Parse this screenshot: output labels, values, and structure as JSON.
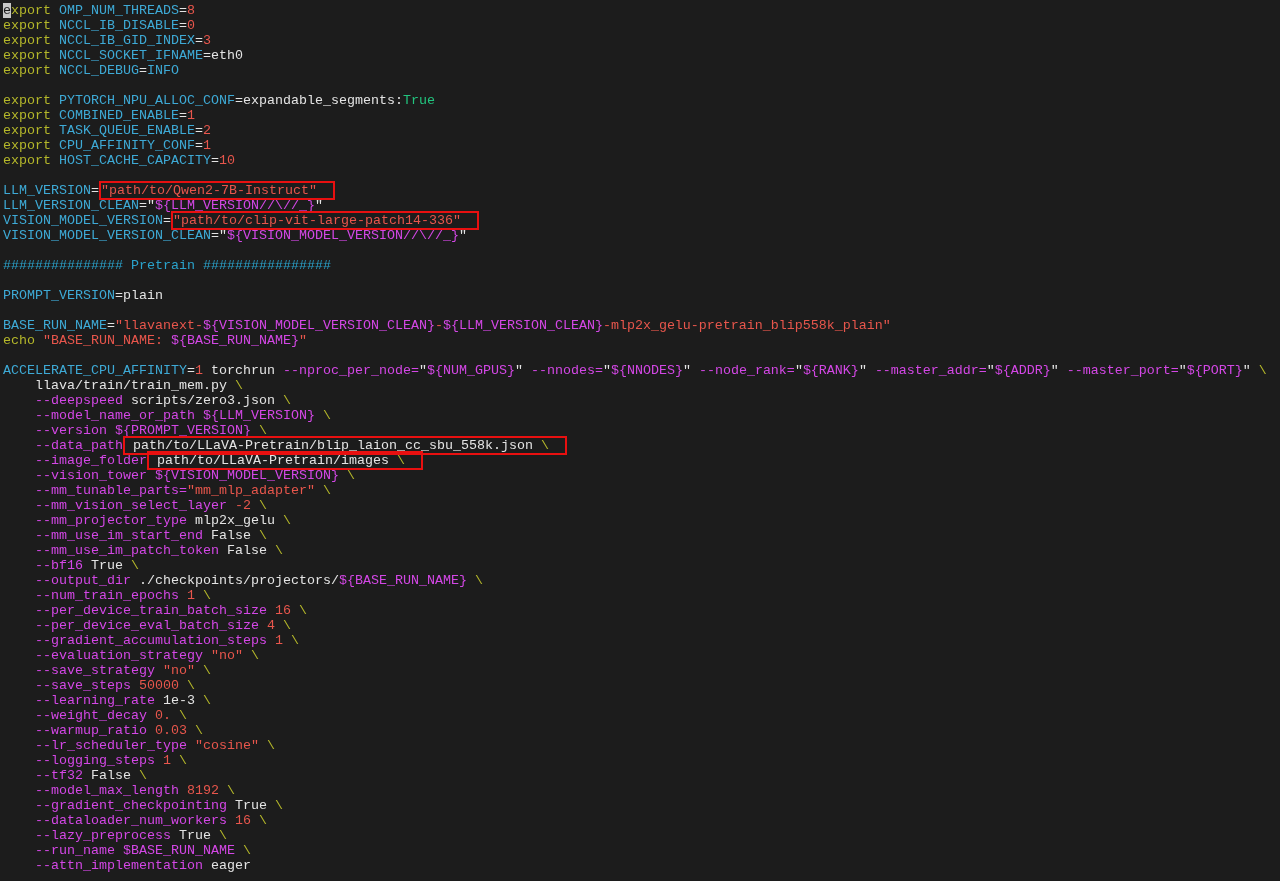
{
  "editor": {
    "lines": [
      {
        "kind": "code",
        "indented": false,
        "tokens": [
          {
            "kind": "cursor",
            "text": "e"
          },
          {
            "kind": "keyword",
            "text": "xport "
          },
          {
            "kind": "var",
            "text": "OMP_NUM_THREADS"
          },
          {
            "kind": "plain",
            "text": "="
          },
          {
            "kind": "num",
            "text": "8"
          }
        ]
      },
      {
        "kind": "code",
        "indented": false,
        "tokens": [
          {
            "kind": "keyword",
            "text": "export "
          },
          {
            "kind": "var",
            "text": "NCCL_IB_DISABLE"
          },
          {
            "kind": "plain",
            "text": "="
          },
          {
            "kind": "num",
            "text": "0"
          }
        ]
      },
      {
        "kind": "code",
        "indented": false,
        "tokens": [
          {
            "kind": "keyword",
            "text": "export "
          },
          {
            "kind": "var",
            "text": "NCCL_IB_GID_INDEX"
          },
          {
            "kind": "plain",
            "text": "="
          },
          {
            "kind": "num",
            "text": "3"
          }
        ]
      },
      {
        "kind": "code",
        "indented": false,
        "tokens": [
          {
            "kind": "keyword",
            "text": "export "
          },
          {
            "kind": "var",
            "text": "NCCL_SOCKET_IFNAME"
          },
          {
            "kind": "plain",
            "text": "=eth0"
          }
        ]
      },
      {
        "kind": "code",
        "indented": false,
        "tokens": [
          {
            "kind": "keyword",
            "text": "export "
          },
          {
            "kind": "var",
            "text": "NCCL_DEBUG"
          },
          {
            "kind": "plain",
            "text": "="
          },
          {
            "kind": "var",
            "text": "INFO"
          }
        ]
      },
      {
        "kind": "blank"
      },
      {
        "kind": "code",
        "indented": false,
        "tokens": [
          {
            "kind": "keyword",
            "text": "export "
          },
          {
            "kind": "var",
            "text": "PYTORCH_NPU_ALLOC_CONF"
          },
          {
            "kind": "plain",
            "text": "=expandable_segments:"
          },
          {
            "kind": "bool",
            "text": "True"
          }
        ]
      },
      {
        "kind": "code",
        "indented": false,
        "tokens": [
          {
            "kind": "keyword",
            "text": "export "
          },
          {
            "kind": "var",
            "text": "COMBINED_ENABLE"
          },
          {
            "kind": "plain",
            "text": "="
          },
          {
            "kind": "num",
            "text": "1"
          }
        ]
      },
      {
        "kind": "code",
        "indented": false,
        "tokens": [
          {
            "kind": "keyword",
            "text": "export "
          },
          {
            "kind": "var",
            "text": "TASK_QUEUE_ENABLE"
          },
          {
            "kind": "plain",
            "text": "="
          },
          {
            "kind": "num",
            "text": "2"
          }
        ]
      },
      {
        "kind": "code",
        "indented": false,
        "tokens": [
          {
            "kind": "keyword",
            "text": "export "
          },
          {
            "kind": "var",
            "text": "CPU_AFFINITY_CONF"
          },
          {
            "kind": "plain",
            "text": "="
          },
          {
            "kind": "num",
            "text": "1"
          }
        ]
      },
      {
        "kind": "code",
        "indented": false,
        "tokens": [
          {
            "kind": "keyword",
            "text": "export "
          },
          {
            "kind": "var",
            "text": "HOST_CACHE_CAPACITY"
          },
          {
            "kind": "plain",
            "text": "="
          },
          {
            "kind": "num",
            "text": "10"
          }
        ]
      },
      {
        "kind": "blank"
      },
      {
        "kind": "code",
        "indented": false,
        "tokens": [
          {
            "kind": "var",
            "text": "LLM_VERSION"
          },
          {
            "kind": "plain",
            "text": "="
          }
        ],
        "boxed": [
          {
            "kind": "str",
            "text": "\"path/to/Qwen2-7B-Instruct\""
          }
        ]
      },
      {
        "kind": "code",
        "indented": false,
        "tokens": [
          {
            "kind": "var",
            "text": "LLM_VERSION_CLEAN"
          },
          {
            "kind": "plain",
            "text": "=\""
          },
          {
            "kind": "expansion",
            "text": "${LLM_VERSION//\\//_}"
          },
          {
            "kind": "plain",
            "text": "\""
          }
        ]
      },
      {
        "kind": "code",
        "indented": false,
        "tokens": [
          {
            "kind": "var",
            "text": "VISION_MODEL_VERSION"
          },
          {
            "kind": "plain",
            "text": "="
          }
        ],
        "boxed": [
          {
            "kind": "str",
            "text": "\"path/to/clip-vit-large-patch14-336\""
          }
        ]
      },
      {
        "kind": "code",
        "indented": false,
        "tokens": [
          {
            "kind": "var",
            "text": "VISION_MODEL_VERSION_CLEAN"
          },
          {
            "kind": "plain",
            "text": "=\""
          },
          {
            "kind": "expansion",
            "text": "${VISION_MODEL_VERSION//\\//_}"
          },
          {
            "kind": "plain",
            "text": "\""
          }
        ]
      },
      {
        "kind": "blank"
      },
      {
        "kind": "code",
        "indented": false,
        "tokens": [
          {
            "kind": "comment",
            "text": "############### Pretrain ################"
          }
        ]
      },
      {
        "kind": "blank"
      },
      {
        "kind": "code",
        "indented": false,
        "tokens": [
          {
            "kind": "var",
            "text": "PROMPT_VERSION"
          },
          {
            "kind": "plain",
            "text": "=plain"
          }
        ]
      },
      {
        "kind": "blank"
      },
      {
        "kind": "code",
        "indented": false,
        "tokens": [
          {
            "kind": "var",
            "text": "BASE_RUN_NAME"
          },
          {
            "kind": "plain",
            "text": "="
          },
          {
            "kind": "str",
            "text": "\"llavanext-"
          },
          {
            "kind": "expansion",
            "text": "${VISION_MODEL_VERSION_CLEAN}"
          },
          {
            "kind": "str",
            "text": "-"
          },
          {
            "kind": "expansion",
            "text": "${LLM_VERSION_CLEAN}"
          },
          {
            "kind": "str",
            "text": "-mlp2x_gelu-pretrain_blip558k_plain\""
          }
        ]
      },
      {
        "kind": "code",
        "indented": false,
        "tokens": [
          {
            "kind": "keyword",
            "text": "echo "
          },
          {
            "kind": "str",
            "text": "\"BASE_RUN_NAME: "
          },
          {
            "kind": "expansion",
            "text": "${BASE_RUN_NAME}"
          },
          {
            "kind": "str",
            "text": "\""
          }
        ]
      },
      {
        "kind": "blank"
      },
      {
        "kind": "code",
        "indented": false,
        "tokens": [
          {
            "kind": "var",
            "text": "ACCELERATE_CPU_AFFINITY"
          },
          {
            "kind": "plain",
            "text": "="
          },
          {
            "kind": "num",
            "text": "1"
          },
          {
            "kind": "plain",
            "text": " torchrun "
          },
          {
            "kind": "flag",
            "text": "--nproc_per_node="
          },
          {
            "kind": "plain",
            "text": "\""
          },
          {
            "kind": "expansion",
            "text": "${NUM_GPUS}"
          },
          {
            "kind": "plain",
            "text": "\" "
          },
          {
            "kind": "flag",
            "text": "--nnodes="
          },
          {
            "kind": "plain",
            "text": "\""
          },
          {
            "kind": "expansion",
            "text": "${NNODES}"
          },
          {
            "kind": "plain",
            "text": "\" "
          },
          {
            "kind": "flag",
            "text": "--node_rank="
          },
          {
            "kind": "plain",
            "text": "\""
          },
          {
            "kind": "expansion",
            "text": "${RANK}"
          },
          {
            "kind": "plain",
            "text": "\" "
          },
          {
            "kind": "flag",
            "text": "--master_addr="
          },
          {
            "kind": "plain",
            "text": "\""
          },
          {
            "kind": "expansion",
            "text": "${ADDR}"
          },
          {
            "kind": "plain",
            "text": "\" "
          },
          {
            "kind": "flag",
            "text": "--master_port="
          },
          {
            "kind": "plain",
            "text": "\""
          },
          {
            "kind": "expansion",
            "text": "${PORT}"
          },
          {
            "kind": "plain",
            "text": "\" "
          },
          {
            "kind": "backslash",
            "text": "\\"
          }
        ]
      },
      {
        "kind": "code",
        "indented": true,
        "tokens": [
          {
            "kind": "plain",
            "text": "llava/train/train_mem.py "
          },
          {
            "kind": "backslash",
            "text": "\\"
          }
        ]
      },
      {
        "kind": "code",
        "indented": true,
        "tokens": [
          {
            "kind": "flag",
            "text": "--deepspeed"
          },
          {
            "kind": "plain",
            "text": " scripts/zero3.json "
          },
          {
            "kind": "backslash",
            "text": "\\"
          }
        ]
      },
      {
        "kind": "code",
        "indented": true,
        "tokens": [
          {
            "kind": "flag",
            "text": "--model_name_or_path "
          },
          {
            "kind": "expansion",
            "text": "${LLM_VERSION} "
          },
          {
            "kind": "backslash",
            "text": "\\"
          }
        ]
      },
      {
        "kind": "code",
        "indented": true,
        "tokens": [
          {
            "kind": "flag",
            "text": "--version "
          },
          {
            "kind": "expansion",
            "text": "${PROMPT_VERSION} "
          },
          {
            "kind": "backslash",
            "text": "\\"
          }
        ]
      },
      {
        "kind": "code",
        "indented": true,
        "tokens": [
          {
            "kind": "flag",
            "text": "--data_path"
          }
        ],
        "boxed": [
          {
            "kind": "plain",
            "text": " path/to/LLaVA-Pretrain/blip_laion_cc_sbu_558k.json "
          },
          {
            "kind": "backslash",
            "text": "\\"
          }
        ]
      },
      {
        "kind": "code",
        "indented": true,
        "tokens": [
          {
            "kind": "flag",
            "text": "--image_folder"
          }
        ],
        "boxed": [
          {
            "kind": "plain",
            "text": " path/to/LLaVA-Pretrain/images "
          },
          {
            "kind": "backslash",
            "text": "\\"
          }
        ]
      },
      {
        "kind": "code",
        "indented": true,
        "tokens": [
          {
            "kind": "flag",
            "text": "--vision_tower "
          },
          {
            "kind": "expansion",
            "text": "${VISION_MODEL_VERSION} "
          },
          {
            "kind": "backslash",
            "text": "\\"
          }
        ]
      },
      {
        "kind": "code",
        "indented": true,
        "tokens": [
          {
            "kind": "flag",
            "text": "--mm_tunable_parts="
          },
          {
            "kind": "str",
            "text": "\"mm_mlp_adapter\" "
          },
          {
            "kind": "backslash",
            "text": "\\"
          }
        ]
      },
      {
        "kind": "code",
        "indented": true,
        "tokens": [
          {
            "kind": "flag",
            "text": "--mm_vision_select_layer "
          },
          {
            "kind": "num",
            "text": "-2 "
          },
          {
            "kind": "backslash",
            "text": "\\"
          }
        ]
      },
      {
        "kind": "code",
        "indented": true,
        "tokens": [
          {
            "kind": "flag",
            "text": "--mm_projector_type"
          },
          {
            "kind": "plain",
            "text": " mlp2x_gelu "
          },
          {
            "kind": "backslash",
            "text": "\\"
          }
        ]
      },
      {
        "kind": "code",
        "indented": true,
        "tokens": [
          {
            "kind": "flag",
            "text": "--mm_use_im_start_end"
          },
          {
            "kind": "plain",
            "text": " False "
          },
          {
            "kind": "backslash",
            "text": "\\"
          }
        ]
      },
      {
        "kind": "code",
        "indented": true,
        "tokens": [
          {
            "kind": "flag",
            "text": "--mm_use_im_patch_token"
          },
          {
            "kind": "plain",
            "text": " False "
          },
          {
            "kind": "backslash",
            "text": "\\"
          }
        ]
      },
      {
        "kind": "code",
        "indented": true,
        "tokens": [
          {
            "kind": "flag",
            "text": "--bf16"
          },
          {
            "kind": "plain",
            "text": " True "
          },
          {
            "kind": "backslash",
            "text": "\\"
          }
        ]
      },
      {
        "kind": "code",
        "indented": true,
        "tokens": [
          {
            "kind": "flag",
            "text": "--output_dir"
          },
          {
            "kind": "plain",
            "text": " ./checkpoints/projectors/"
          },
          {
            "kind": "expansion",
            "text": "${BASE_RUN_NAME} "
          },
          {
            "kind": "backslash",
            "text": "\\"
          }
        ]
      },
      {
        "kind": "code",
        "indented": true,
        "tokens": [
          {
            "kind": "flag",
            "text": "--num_train_epochs "
          },
          {
            "kind": "num",
            "text": "1 "
          },
          {
            "kind": "backslash",
            "text": "\\"
          }
        ]
      },
      {
        "kind": "code",
        "indented": true,
        "tokens": [
          {
            "kind": "flag",
            "text": "--per_device_train_batch_size "
          },
          {
            "kind": "num",
            "text": "16 "
          },
          {
            "kind": "backslash",
            "text": "\\"
          }
        ]
      },
      {
        "kind": "code",
        "indented": true,
        "tokens": [
          {
            "kind": "flag",
            "text": "--per_device_eval_batch_size "
          },
          {
            "kind": "num",
            "text": "4 "
          },
          {
            "kind": "backslash",
            "text": "\\"
          }
        ]
      },
      {
        "kind": "code",
        "indented": true,
        "tokens": [
          {
            "kind": "flag",
            "text": "--gradient_accumulation_steps "
          },
          {
            "kind": "num",
            "text": "1 "
          },
          {
            "kind": "backslash",
            "text": "\\"
          }
        ]
      },
      {
        "kind": "code",
        "indented": true,
        "tokens": [
          {
            "kind": "flag",
            "text": "--evaluation_strategy "
          },
          {
            "kind": "str",
            "text": "\"no\" "
          },
          {
            "kind": "backslash",
            "text": "\\"
          }
        ]
      },
      {
        "kind": "code",
        "indented": true,
        "tokens": [
          {
            "kind": "flag",
            "text": "--save_strategy "
          },
          {
            "kind": "str",
            "text": "\"no\" "
          },
          {
            "kind": "backslash",
            "text": "\\"
          }
        ]
      },
      {
        "kind": "code",
        "indented": true,
        "tokens": [
          {
            "kind": "flag",
            "text": "--save_steps "
          },
          {
            "kind": "num",
            "text": "50000 "
          },
          {
            "kind": "backslash",
            "text": "\\"
          }
        ]
      },
      {
        "kind": "code",
        "indented": true,
        "tokens": [
          {
            "kind": "flag",
            "text": "--learning_rate"
          },
          {
            "kind": "plain",
            "text": " 1e-3 "
          },
          {
            "kind": "backslash",
            "text": "\\"
          }
        ]
      },
      {
        "kind": "code",
        "indented": true,
        "tokens": [
          {
            "kind": "flag",
            "text": "--weight_decay "
          },
          {
            "kind": "num",
            "text": "0. "
          },
          {
            "kind": "backslash",
            "text": "\\"
          }
        ]
      },
      {
        "kind": "code",
        "indented": true,
        "tokens": [
          {
            "kind": "flag",
            "text": "--warmup_ratio "
          },
          {
            "kind": "num",
            "text": "0.03 "
          },
          {
            "kind": "backslash",
            "text": "\\"
          }
        ]
      },
      {
        "kind": "code",
        "indented": true,
        "tokens": [
          {
            "kind": "flag",
            "text": "--lr_scheduler_type "
          },
          {
            "kind": "str",
            "text": "\"cosine\" "
          },
          {
            "kind": "backslash",
            "text": "\\"
          }
        ]
      },
      {
        "kind": "code",
        "indented": true,
        "tokens": [
          {
            "kind": "flag",
            "text": "--logging_steps "
          },
          {
            "kind": "num",
            "text": "1 "
          },
          {
            "kind": "backslash",
            "text": "\\"
          }
        ]
      },
      {
        "kind": "code",
        "indented": true,
        "tokens": [
          {
            "kind": "flag",
            "text": "--tf32"
          },
          {
            "kind": "plain",
            "text": " False "
          },
          {
            "kind": "backslash",
            "text": "\\"
          }
        ]
      },
      {
        "kind": "code",
        "indented": true,
        "tokens": [
          {
            "kind": "flag",
            "text": "--model_max_length "
          },
          {
            "kind": "num",
            "text": "8192 "
          },
          {
            "kind": "backslash",
            "text": "\\"
          }
        ]
      },
      {
        "kind": "code",
        "indented": true,
        "tokens": [
          {
            "kind": "flag",
            "text": "--gradient_checkpointing"
          },
          {
            "kind": "plain",
            "text": " True "
          },
          {
            "kind": "backslash",
            "text": "\\"
          }
        ]
      },
      {
        "kind": "code",
        "indented": true,
        "tokens": [
          {
            "kind": "flag",
            "text": "--dataloader_num_workers "
          },
          {
            "kind": "num",
            "text": "16 "
          },
          {
            "kind": "backslash",
            "text": "\\"
          }
        ]
      },
      {
        "kind": "code",
        "indented": true,
        "tokens": [
          {
            "kind": "flag",
            "text": "--lazy_preprocess"
          },
          {
            "kind": "plain",
            "text": " True "
          },
          {
            "kind": "backslash",
            "text": "\\"
          }
        ]
      },
      {
        "kind": "code",
        "indented": true,
        "tokens": [
          {
            "kind": "flag",
            "text": "--run_name "
          },
          {
            "kind": "expansion",
            "text": "$BASE_RUN_NAME "
          },
          {
            "kind": "backslash",
            "text": "\\"
          }
        ]
      },
      {
        "kind": "code",
        "indented": true,
        "tokens": [
          {
            "kind": "flag",
            "text": "--attn_implementation"
          },
          {
            "kind": "plain",
            "text": " eager"
          }
        ]
      }
    ]
  }
}
